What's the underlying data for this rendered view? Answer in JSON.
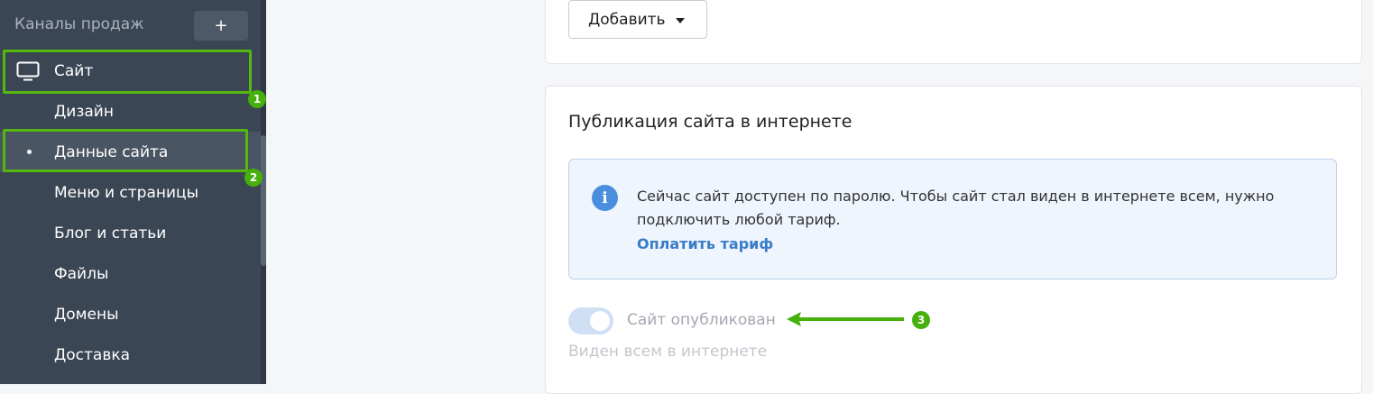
{
  "sidebar": {
    "title": "Каналы продаж",
    "add_label": "+",
    "items": [
      {
        "label": "Сайт",
        "icon": "monitor-icon"
      },
      {
        "label": "Дизайн"
      },
      {
        "label": "Данные сайта"
      },
      {
        "label": "Меню и страницы"
      },
      {
        "label": "Блог и статьи"
      },
      {
        "label": "Файлы"
      },
      {
        "label": "Домены"
      },
      {
        "label": "Доставка"
      }
    ]
  },
  "markers": [
    "1",
    "2",
    "3"
  ],
  "main": {
    "add_button_label": "Добавить",
    "section_title": "Публикация сайта в интернете",
    "info": {
      "icon": "info-icon",
      "text": "Сейчас сайт доступен по паролю. Чтобы сайт стал виден в интернете всем, нужно подключить любой тариф.",
      "link": "Оплатить тариф"
    },
    "toggle": {
      "label": "Сайт опубликован",
      "sublabel": "Виден всем в интернете",
      "state": "on-disabled"
    }
  },
  "colors": {
    "sidebar_bg": "#3b4654",
    "highlight": "#54b80f",
    "link": "#3a7cc8",
    "info_bg": "#eef5fd"
  }
}
